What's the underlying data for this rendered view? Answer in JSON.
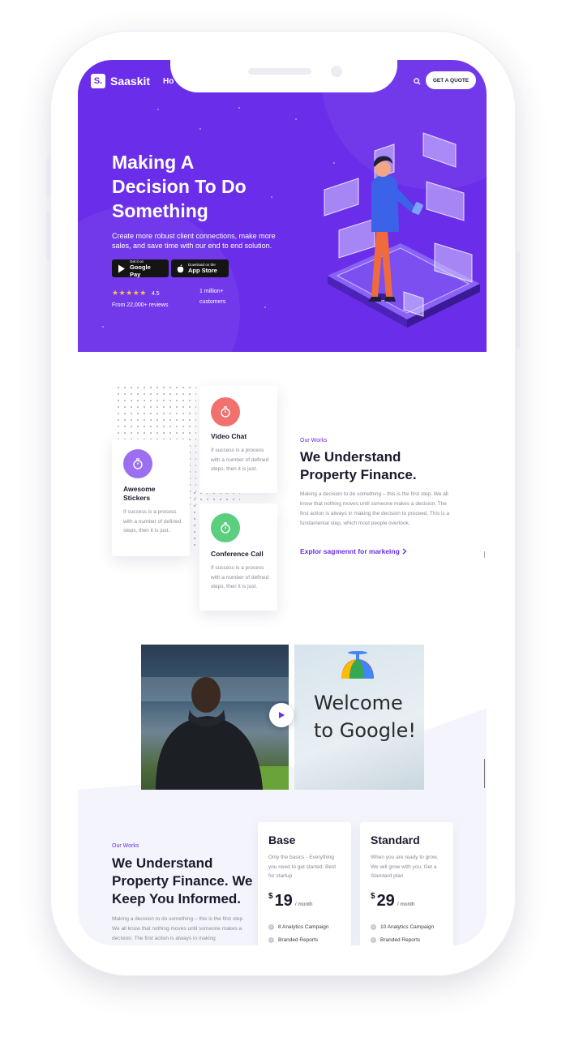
{
  "nav": {
    "logo_mark": "S.",
    "logo_text": "Saaskit",
    "home_link": "Ho",
    "cta_label": "GET A QUOTE"
  },
  "hero": {
    "title_lines": [
      "Making A",
      "Decision To Do",
      "Something"
    ],
    "subtitle": "Create more robust client connections, make more sales, and save time with our end to end solution.",
    "google_pay": {
      "small": "Get it on",
      "big": "Google Pay"
    },
    "app_store": {
      "small": "Download on the",
      "big": "App Store"
    },
    "rating": {
      "stars": "★★★★★",
      "value": "4.5",
      "reviews": "From 22,000+ reviews"
    },
    "customers": "1 million+ customers"
  },
  "features": {
    "cards": [
      {
        "title": "Video Chat",
        "text": "If success is a process with a number of defined steps, then it is just.",
        "color": "#f2716f"
      },
      {
        "title": "Awesome Stickers",
        "text": "If success is a process with a number of defined steps, then it is just.",
        "color": "#9b6ff0"
      },
      {
        "title": "Conference Call",
        "text": "If success is a process with a number of defined steps, then it is just.",
        "color": "#5ccf7f"
      }
    ],
    "eyebrow": "Our Works",
    "title_lines": [
      "We Understand",
      "Property Finance."
    ],
    "body": "Making a decision to do something – this is the first step. We all know that nothing moves until someone makes a decision. The first action is always in making the decision to proceed. This is a fundamental step, which most people overlook.",
    "link": "Explor sagmennt for markeing"
  },
  "video": {
    "sign_text": "Welcome to Google!"
  },
  "pricing": {
    "eyebrow": "Our Works",
    "title_lines": [
      "We Understand",
      "Property Finance. We",
      "Keep You Informed."
    ],
    "body": "Making a decision to do something – this is the first step. We all know that nothing moves until someone makes a decision. The first action is always in making",
    "plans": [
      {
        "name": "Base",
        "desc": "Only the basics - Everything you need to get started. Best for startup",
        "currency": "$",
        "price": "19",
        "period": "/ month",
        "features": [
          "8 Analytics Campaign",
          "Branded Reports"
        ]
      },
      {
        "name": "Standard",
        "desc": "When you are ready to grow, We will grow with you. Get a Standard plan",
        "currency": "$",
        "price": "29",
        "period": "/ month",
        "features": [
          "10 Analytics Campaign",
          "Branded Reports"
        ]
      }
    ]
  },
  "colors": {
    "brand": "#6a2de9",
    "accent_star": "#f7c348"
  }
}
